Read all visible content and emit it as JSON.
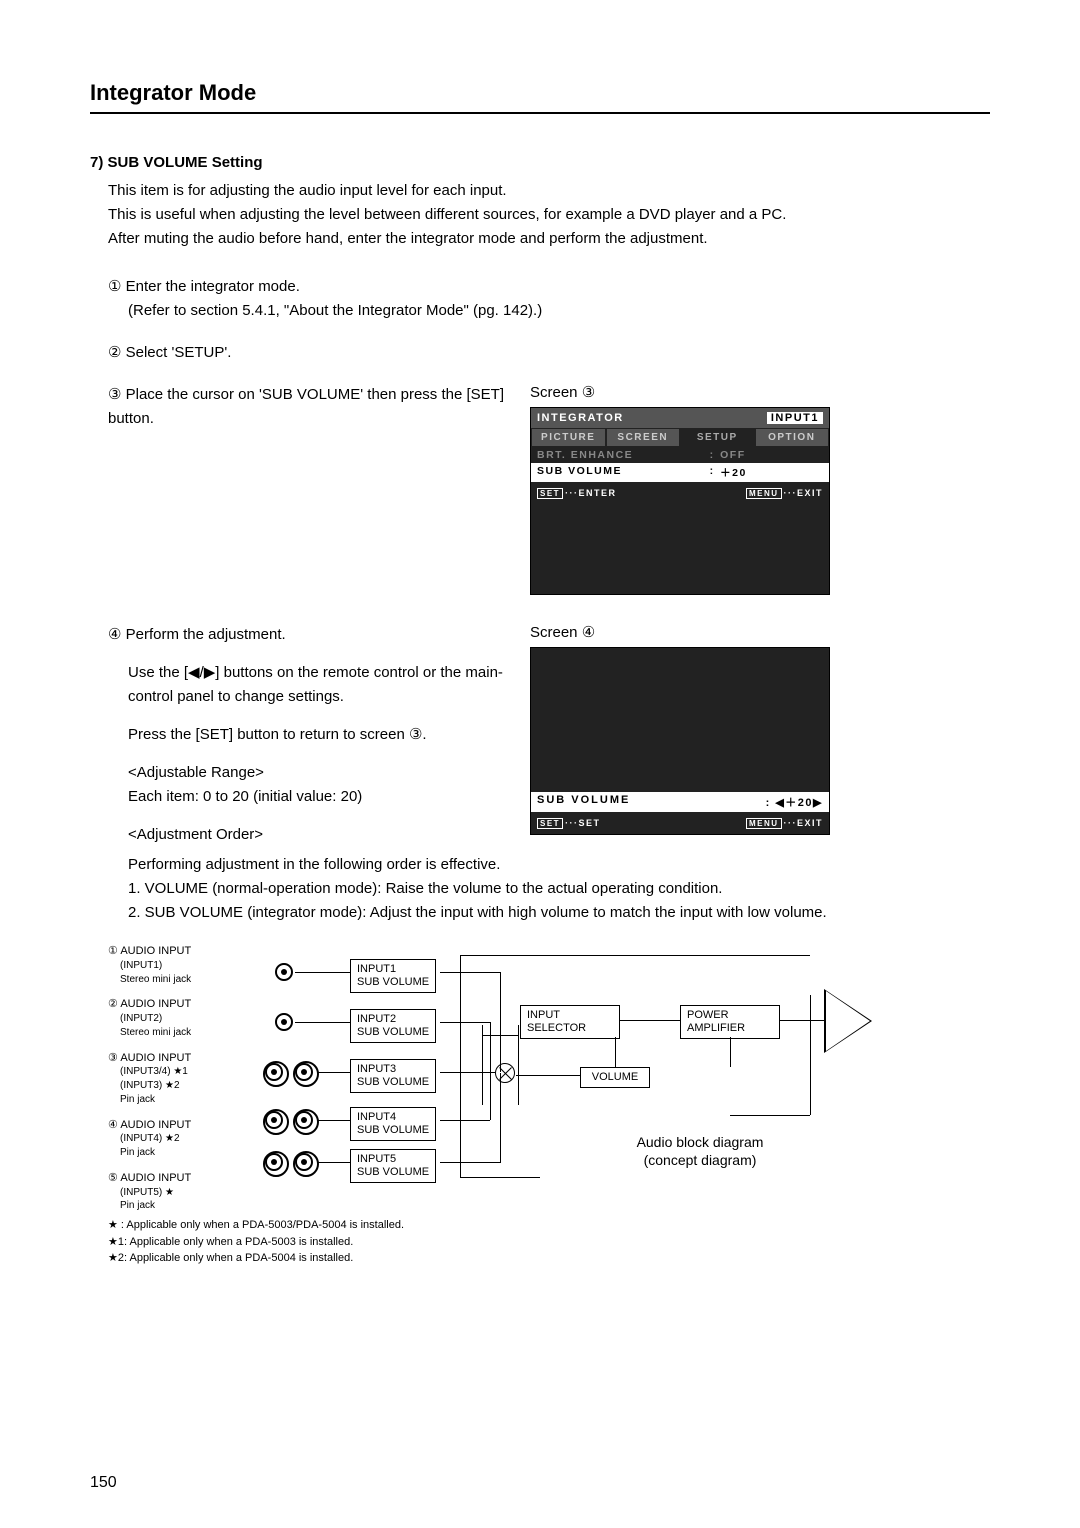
{
  "page": {
    "title": "Integrator Mode",
    "number": "150"
  },
  "section": {
    "num": "7)",
    "heading": "SUB VOLUME Setting",
    "intro1": "This item is for adjusting the audio input level for each input.",
    "intro2": "This is useful when adjusting the level between different sources, for example a DVD player and a PC.",
    "intro3": "After muting the audio before hand, enter the integrator mode and perform the adjustment."
  },
  "steps": {
    "s1": "① Enter the integrator mode.",
    "s1b": "(Refer to section 5.4.1, \"About the Integrator Mode\" (pg. 142).)",
    "s2": "② Select 'SETUP'.",
    "s3": "③ Place the cursor on 'SUB VOLUME' then press the [SET] button.",
    "s4": "④ Perform the adjustment.",
    "s4b": "Use the [◀/▶] buttons on the remote control or the main-control panel to change settings.",
    "s4c": "Press the [SET] button to return to screen ③.",
    "range_h": "<Adjustable Range>",
    "range_v": "Each item:  0 to 20 (initial value: 20)",
    "order_h": "<Adjustment Order>",
    "order_1": "Performing adjustment in the following order is effective.",
    "order_2": "1. VOLUME (normal-operation mode):  Raise the volume to the actual operating condition.",
    "order_3": "2. SUB VOLUME (integrator mode): Adjust the input with high volume to match the input with low volume."
  },
  "screens": {
    "label3": "Screen ③",
    "label4": "Screen ④",
    "osd3": {
      "title": "INTEGRATOR",
      "src": "INPUT1",
      "tabs": [
        "PICTURE",
        "SCREEN",
        "SETUP",
        "OPTION"
      ],
      "row1_label": "BRT. ENHANCE",
      "row1_val": "OFF",
      "row2_label": "SUB VOLUME",
      "row2_val": "＋20",
      "foot_l_key": "SET",
      "foot_l_txt": "···ENTER",
      "foot_r_key": "MENU",
      "foot_r_txt": "···EXIT"
    },
    "osd4": {
      "label": "SUB VOLUME",
      "value": ": ◀＋20▶",
      "foot_l_key": "SET",
      "foot_l_txt": "···SET",
      "foot_r_key": "MENU",
      "foot_r_txt": "···EXIT"
    }
  },
  "diagram": {
    "inputs": [
      {
        "n": "①",
        "t": "AUDIO INPUT",
        "s1": "(INPUT1)",
        "s2": "Stereo mini jack"
      },
      {
        "n": "②",
        "t": "AUDIO INPUT",
        "s1": "(INPUT2)",
        "s2": "Stereo mini jack"
      },
      {
        "n": "③",
        "t": "AUDIO INPUT",
        "s1": "(INPUT3/4) ★1",
        "s2": "(INPUT3) ★2",
        "s3": "Pin jack"
      },
      {
        "n": "④",
        "t": "AUDIO INPUT",
        "s1": "(INPUT4) ★2",
        "s2": "Pin jack"
      },
      {
        "n": "⑤",
        "t": "AUDIO INPUT",
        "s1": "(INPUT5) ★",
        "s2": "Pin jack"
      }
    ],
    "sv": [
      "INPUT1\nSUB VOLUME",
      "INPUT2\nSUB VOLUME",
      "INPUT3\nSUB VOLUME",
      "INPUT4\nSUB VOLUME",
      "INPUT5\nSUB VOLUME"
    ],
    "selector": "INPUT\nSELECTOR",
    "amp": "POWER\nAMPLIFIER",
    "volume": "VOLUME",
    "caption1": "Audio block diagram",
    "caption2": "(concept diagram)"
  },
  "footnotes": {
    "f1": "★  : Applicable only when a PDA-5003/PDA-5004 is installed.",
    "f2": "★1: Applicable only when a PDA-5003 is installed.",
    "f3": "★2: Applicable only when a PDA-5004 is installed."
  }
}
